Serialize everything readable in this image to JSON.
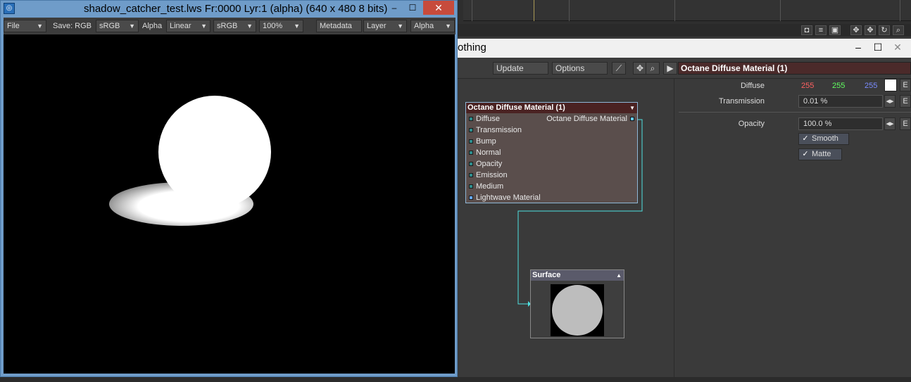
{
  "background": {
    "icons": [
      "camera-icon",
      "list-icon",
      "save-icon",
      "move-icon",
      "move-all-icon",
      "rotate-icon",
      "zoom-icon",
      "fit-icon"
    ],
    "icon_glyphs": [
      "◘",
      "≡",
      "▣",
      "✥",
      "✥",
      "↻",
      "⌕",
      "⛶"
    ]
  },
  "node_editor": {
    "title": "othing",
    "toolbar": {
      "update_label": "Update",
      "options_label": "Options",
      "material_title": "Octane Diffuse Material (1)"
    },
    "nodes": {
      "octane": {
        "title": "Octane Diffuse Material (1)",
        "output_label": "Octane Diffuse Material",
        "inputs": [
          "Diffuse",
          "Transmission",
          "Bump",
          "Normal",
          "Opacity",
          "Emission",
          "Medium",
          "Lightwave Material"
        ]
      },
      "surface": {
        "title": "Surface"
      }
    },
    "colors": {
      "wire": "#4fe0e0",
      "node_header": "#4a2222"
    }
  },
  "properties": {
    "diffuse": {
      "label": "Diffuse",
      "r": "255",
      "g": "255",
      "b": "255",
      "r_color": "#ff6060",
      "g_color": "#60ff60",
      "b_color": "#7a8cff"
    },
    "transmission": {
      "label": "Transmission",
      "value": "0.01 %"
    },
    "opacity": {
      "label": "Opacity",
      "value": "100.0 %"
    },
    "smooth_label": "Smooth",
    "matte_label": "Matte",
    "e_label": "E"
  },
  "viewer": {
    "title": "shadow_catcher_test.lws Fr:0000 Lyr:1 (alpha)  (640 x 480 8 bits)",
    "toolbar": {
      "file": "File",
      "save_label": "Save: RGB",
      "save_space": "sRGB",
      "alpha_label": "Alpha",
      "alpha_mode": "Linear",
      "color_space": "sRGB",
      "zoom": "100%",
      "metadata": "Metadata",
      "layer": "Layer",
      "channel": "Alpha"
    }
  }
}
